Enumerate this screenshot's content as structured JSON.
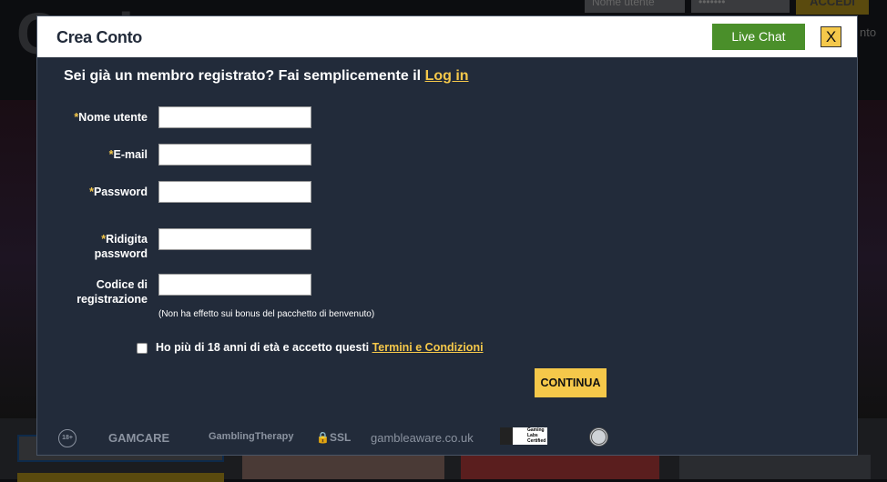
{
  "background": {
    "logo": "Casino",
    "username_placeholder": "Nome utente",
    "password_mask": "•••••••",
    "login_button": "ACCEDI",
    "side_text": "nto"
  },
  "modal": {
    "title": "Crea Conto",
    "live_chat": "Live Chat",
    "close": "X",
    "member_text": "Sei già un membro registrato? Fai semplicemente il",
    "login_link": "Log in",
    "fields": [
      {
        "required": "*",
        "label": "Nome utente",
        "value": ""
      },
      {
        "required": "*",
        "label": "E-mail",
        "value": ""
      },
      {
        "required": "*",
        "label": "Password",
        "value": ""
      },
      {
        "required": "*",
        "label": "Ridigita password",
        "value": ""
      },
      {
        "required": "",
        "label": "Codice di registrazione",
        "value": ""
      }
    ],
    "code_note": "(Non ha effetto sui bonus del pacchetto di benvenuto)",
    "terms_checked": false,
    "terms_text": "Ho più di 18 anni di età e accetto questi",
    "terms_link": "Termini e Condizioni",
    "continue": "CONTINUA",
    "logos": [
      "18+",
      "GAMCARE",
      "GamblingTherapy",
      "SSL",
      "gambleaware.co.uk",
      "Gaming Labs Certified"
    ]
  },
  "colors": {
    "accent": "#f5c84a",
    "live_chat": "#4a8f2a",
    "modal_body": "#222b3a"
  }
}
